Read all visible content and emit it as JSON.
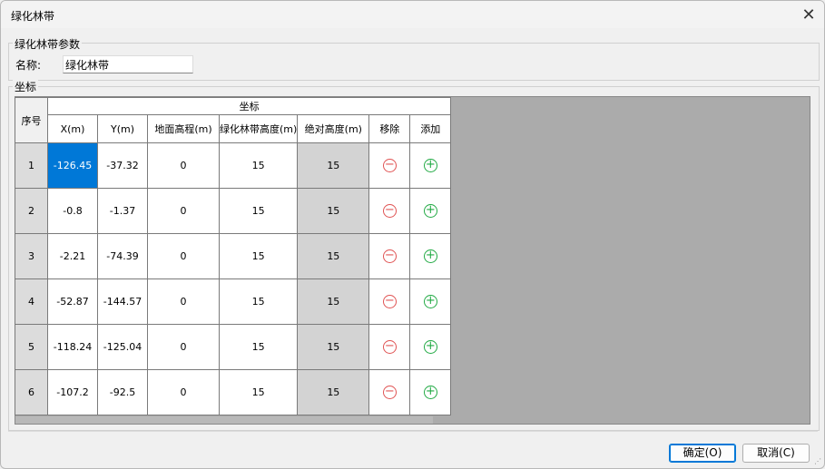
{
  "window": {
    "title": "绿化林带"
  },
  "params": {
    "group_label": "绿化林带参数",
    "name_label": "名称:",
    "name_value": "绿化林带"
  },
  "coords": {
    "group_label": "坐标",
    "header_group": "坐标",
    "columns": {
      "index": "序号",
      "x": "X(m)",
      "y": "Y(m)",
      "ground": "地面高程(m)",
      "belt_height": "绿化林带高度(m)",
      "abs_height": "绝对高度(m)",
      "remove": "移除",
      "add": "添加"
    },
    "rows": [
      {
        "index": "1",
        "x": "-126.45",
        "y": "-37.32",
        "ground": "0",
        "belt_height": "15",
        "abs_height": "15"
      },
      {
        "index": "2",
        "x": "-0.8",
        "y": "-1.37",
        "ground": "0",
        "belt_height": "15",
        "abs_height": "15"
      },
      {
        "index": "3",
        "x": "-2.21",
        "y": "-74.39",
        "ground": "0",
        "belt_height": "15",
        "abs_height": "15"
      },
      {
        "index": "4",
        "x": "-52.87",
        "y": "-144.57",
        "ground": "0",
        "belt_height": "15",
        "abs_height": "15"
      },
      {
        "index": "5",
        "x": "-118.24",
        "y": "-125.04",
        "ground": "0",
        "belt_height": "15",
        "abs_height": "15"
      },
      {
        "index": "6",
        "x": "-107.2",
        "y": "-92.5",
        "ground": "0",
        "belt_height": "15",
        "abs_height": "15"
      }
    ]
  },
  "icons": {
    "remove": "minus-circle-icon",
    "add": "plus-circle-icon",
    "close": "close-icon"
  },
  "colors": {
    "selection": "#0078d7",
    "remove": "#e05353",
    "add": "#22aa44",
    "grid_background": "#ababab"
  },
  "buttons": {
    "ok": "确定(O)",
    "cancel": "取消(C)"
  }
}
